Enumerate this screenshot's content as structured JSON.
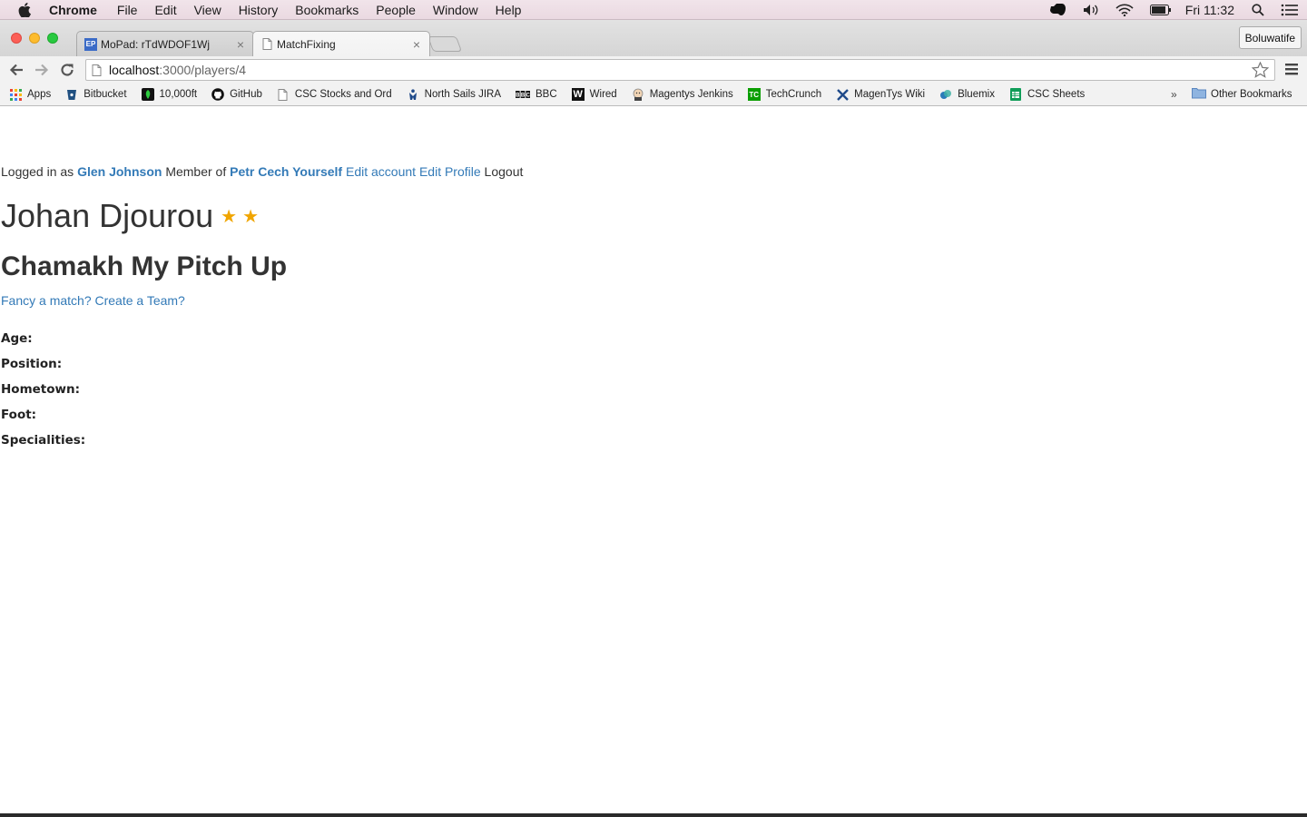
{
  "menubar": {
    "app": "Chrome",
    "items": [
      "File",
      "Edit",
      "View",
      "History",
      "Bookmarks",
      "People",
      "Window",
      "Help"
    ],
    "clock": "Fri 11:32"
  },
  "tabs": [
    {
      "title": "MoPad: rTdWDOF1Wj",
      "favicon": "EP",
      "active": false
    },
    {
      "title": "MatchFixing",
      "active": true
    }
  ],
  "profile_button": "Boluwatife",
  "address": {
    "host": "localhost",
    "path": ":3000/players/4"
  },
  "bookmarks": [
    {
      "label": "Apps",
      "icon": "apps-grid-icon"
    },
    {
      "label": "Bitbucket",
      "icon": "bitbucket-icon"
    },
    {
      "label": "10,000ft",
      "icon": "10000ft-icon"
    },
    {
      "label": "GitHub",
      "icon": "github-icon"
    },
    {
      "label": "CSC Stocks and Ord",
      "icon": "page-icon"
    },
    {
      "label": "North Sails JIRA",
      "icon": "jira-icon"
    },
    {
      "label": "BBC",
      "icon": "bbc-icon"
    },
    {
      "label": "Wired",
      "icon": "wired-icon"
    },
    {
      "label": "Magentys Jenkins",
      "icon": "jenkins-icon"
    },
    {
      "label": "TechCrunch",
      "icon": "techcrunch-icon"
    },
    {
      "label": "MagenTys Wiki",
      "icon": "wiki-icon"
    },
    {
      "label": "Bluemix",
      "icon": "bluemix-icon"
    },
    {
      "label": "CSC Sheets",
      "icon": "sheets-icon"
    }
  ],
  "bookmarks_overflow": "»",
  "other_bookmarks": "Other Bookmarks",
  "page": {
    "login": {
      "prefix": "Logged in as",
      "user": "Glen Johnson",
      "member_of": "Member of",
      "team": "Petr Cech Yourself",
      "edit_account": "Edit account",
      "edit_profile": "Edit Profile",
      "logout": "Logout"
    },
    "player_name": "Johan Djourou",
    "rating": 2,
    "team_name": "Chamakh My Pitch Up",
    "cta": "Fancy a match? Create a Team?",
    "attributes": [
      "Age:",
      "Position:",
      "Hometown:",
      "Foot:",
      "Specialities:"
    ]
  },
  "colors": {
    "link": "#337ab7",
    "star": "#f0a500"
  }
}
